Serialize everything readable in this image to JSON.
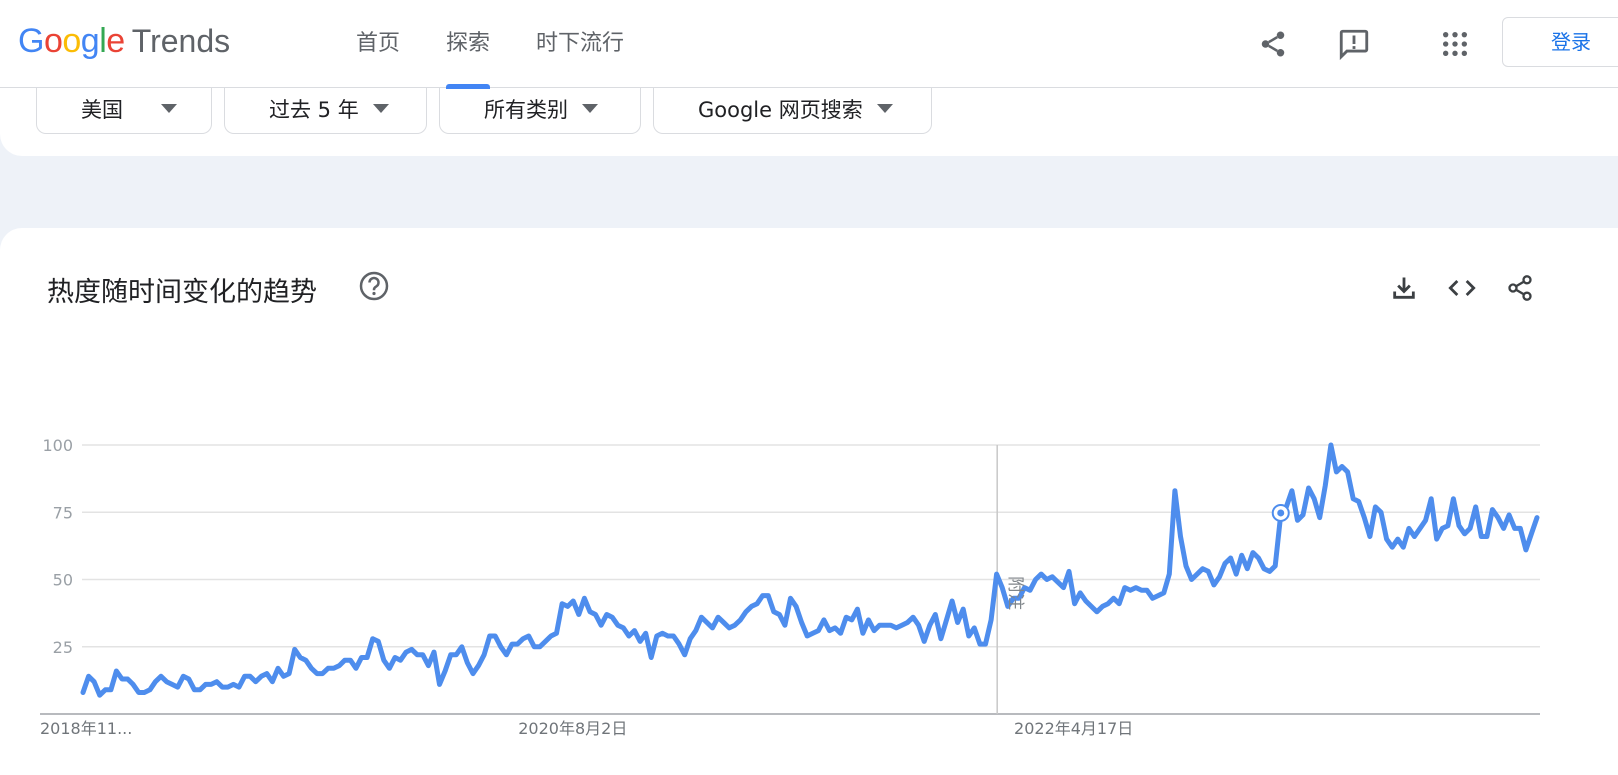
{
  "header": {
    "logo_google": "Google",
    "logo_trends": "Trends",
    "nav": [
      "首页",
      "探索",
      "时下流行"
    ],
    "active_nav": 1,
    "signin_label": "登录"
  },
  "filters": {
    "region": "美国",
    "time_range": "过去 5 年",
    "category": "所有类别",
    "search_type": "Google 网页搜索"
  },
  "card": {
    "title": "热度随时间变化的趋势",
    "note_label": "附注"
  },
  "colors": {
    "line": "#4e8ded",
    "accent": "#4285f4",
    "grid": "#e3e3e3"
  },
  "chart_data": {
    "type": "line",
    "title": "",
    "ylim": [
      0,
      100
    ],
    "yticks": [
      25,
      50,
      75,
      100
    ],
    "grid": true,
    "x_tick_labels": [
      "2018年11...",
      "2020年8月2日",
      "2022年4月17日"
    ],
    "x_tick_index": [
      0,
      88,
      177
    ],
    "note_index": [
      165,
      215
    ],
    "series": [
      {
        "values": [
          8,
          14,
          12,
          7,
          9,
          9,
          16,
          13,
          13,
          11,
          8,
          8,
          9,
          12,
          14,
          12,
          11,
          10,
          14,
          13,
          9,
          9,
          11,
          11,
          12,
          10,
          10,
          11,
          10,
          14,
          14,
          12,
          14,
          15,
          12,
          17,
          14,
          15,
          24,
          21,
          20,
          17,
          15,
          15,
          17,
          17,
          18,
          20,
          20,
          17,
          21,
          21,
          28,
          27,
          20,
          17,
          21,
          20,
          23,
          24,
          22,
          22,
          18,
          23,
          11,
          16,
          22,
          22,
          25,
          19,
          15,
          18,
          22,
          29,
          29,
          25,
          22,
          26,
          26,
          28,
          29,
          25,
          25,
          27,
          29,
          30,
          41,
          40,
          42,
          37,
          43,
          38,
          37,
          33,
          37,
          36,
          33,
          32,
          29,
          31,
          27,
          30,
          21,
          29,
          30,
          29,
          29,
          26,
          22,
          28,
          31,
          36,
          34,
          32,
          36,
          34,
          32,
          33,
          35,
          38,
          40,
          41,
          44,
          44,
          38,
          37,
          33,
          43,
          40,
          34,
          29,
          30,
          31,
          35,
          31,
          32,
          30,
          36,
          35,
          39,
          30,
          35,
          31,
          33,
          33,
          33,
          32,
          33,
          34,
          36,
          33,
          27,
          33,
          37,
          28,
          35,
          42,
          34,
          39,
          29,
          32,
          26,
          26,
          35,
          52,
          47,
          40,
          43,
          43,
          47,
          46,
          50,
          52,
          50,
          51,
          49,
          47,
          53,
          41,
          45,
          42,
          40,
          38,
          40,
          41,
          43,
          41,
          47,
          46,
          47,
          46,
          46,
          43,
          44,
          45,
          52,
          83,
          66,
          55,
          50,
          52,
          54,
          53,
          48,
          51,
          56,
          58,
          52,
          59,
          54,
          60,
          58,
          54,
          53,
          55,
          74,
          77,
          83,
          72,
          74,
          84,
          80,
          73,
          85,
          100,
          90,
          92,
          90,
          80,
          79,
          73,
          66,
          77,
          75,
          65,
          62,
          65,
          62,
          69,
          66,
          69,
          72,
          80,
          65,
          69,
          70,
          80,
          70,
          67,
          69,
          77,
          66,
          66,
          76,
          73,
          69,
          74,
          69,
          69,
          61,
          67,
          73
        ]
      }
    ]
  }
}
